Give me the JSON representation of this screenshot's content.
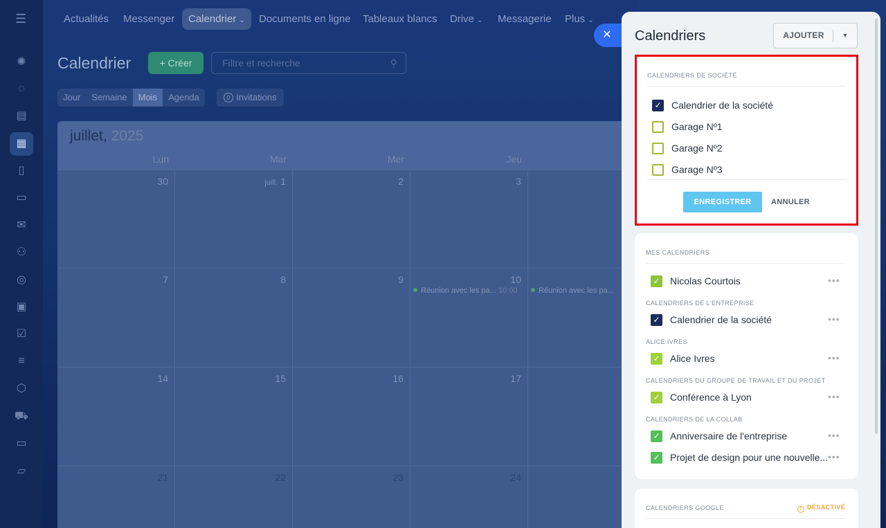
{
  "topnav": {
    "items": [
      "Actualités",
      "Messenger",
      "Calendrier",
      "Documents en ligne",
      "Tableaux blancs",
      "Drive",
      "Messagerie",
      "Plus"
    ]
  },
  "calendar": {
    "title": "Calendrier",
    "create_label": "+ Créer",
    "search_placeholder": "Filtre et recherche",
    "views": [
      "Jour",
      "Semaine",
      "Mois",
      "Agenda"
    ],
    "active_view": "Mois",
    "invites_count": "0",
    "invites_label": "Invitations",
    "month": "juillet,",
    "year": " 2025",
    "day_headers": [
      "Lun",
      "Mar",
      "Mer",
      "Jeu"
    ],
    "week1": [
      "30",
      "1",
      "2",
      "3"
    ],
    "week1_prefix": "juill.",
    "week2": [
      "7",
      "8",
      "9",
      "10"
    ],
    "week3": [
      "14",
      "15",
      "16",
      "17"
    ],
    "week4": [
      "21",
      "22",
      "23",
      "24"
    ],
    "event_title": "Réunion avec les pa...",
    "event_time": "10:00",
    "event_title_2": "Réunion avec les pa..."
  },
  "panel": {
    "title": "Calendriers",
    "add_label": "AJOUTER",
    "company": {
      "label": "CALENDRIERS DE SOCIÉTÉ",
      "items": [
        {
          "name": "Calendrier de la société",
          "checked": true,
          "color": "#1b2d5e"
        },
        {
          "name": "Garage Nº1",
          "checked": false
        },
        {
          "name": "Garage Nº2",
          "checked": false
        },
        {
          "name": "Garage Nº3",
          "checked": false
        }
      ],
      "save_label": "ENREGISTRER",
      "cancel_label": "ANNULER"
    },
    "mine": {
      "label": "MES CALENDRIERS",
      "owner": "Nicolas Courtois",
      "owner_color": "#8cc43a",
      "enterprise_label": "CALENDRIERS DE L'ENTREPRISE",
      "enterprise_item": "Calendrier de la société",
      "enterprise_color": "#1b2d5e",
      "alice_label": "ALICE IVRES",
      "alice_item": "Alice Ivres",
      "alice_color": "#9fd03a",
      "group_label": "CALENDRIERS DU GROUPE DE TRAVAIL ET DU PROJET",
      "group_item": "Conférence à Lyon",
      "group_color": "#9fd03a",
      "collab_label": "CALENDRIERS DE LA COLLAB",
      "collab_items": [
        "Anniversaire de l'entreprise",
        "Projet de design pour une nouvelle..."
      ],
      "collab_color": "#55c05a",
      "more": "•••"
    },
    "google": {
      "label": "CALENDRIERS GOOGLE",
      "status": "DÉSACTIVÉ"
    }
  }
}
